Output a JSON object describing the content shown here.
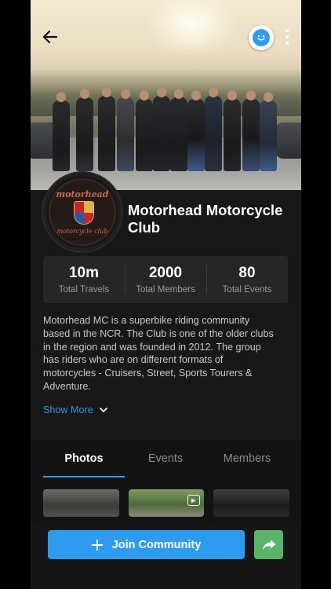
{
  "club": {
    "name": "Motorhead Motorcycle Club",
    "logo_text_top": "motorhead",
    "logo_text_bottom": "motorcycle club"
  },
  "header": {
    "back_icon": "arrow-left-icon",
    "chat_icon": "chat-bubble-icon",
    "more_icon": "more-vertical-icon"
  },
  "stats": [
    {
      "value": "10m",
      "label": "Total Travels"
    },
    {
      "value": "2000",
      "label": "Total Members"
    },
    {
      "value": "80",
      "label": "Total Events"
    }
  ],
  "description": "Motorhead MC is a superbike riding community based in the NCR. The Club is one of the older clubs in the region and was founded in 2012. The group has riders who are on different formats of motorcycles - Cruisers, Street, Sports Tourers & Adventure.",
  "show_more_label": "Show More",
  "tabs": [
    {
      "label": "Photos",
      "active": true
    },
    {
      "label": "Events",
      "active": false
    },
    {
      "label": "Members",
      "active": false
    }
  ],
  "actions": {
    "join_label": "Join Community",
    "share_icon": "share-arrow-icon"
  },
  "colors": {
    "accent": "#2d9cf0",
    "share": "#59b46a",
    "background": "#181818"
  }
}
